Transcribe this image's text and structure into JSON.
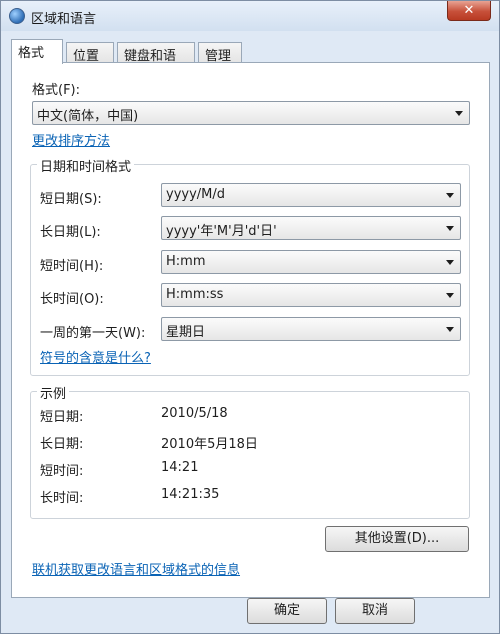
{
  "window": {
    "title": "区域和语言",
    "close_glyph": "✕"
  },
  "tabs": [
    {
      "label": "格式"
    },
    {
      "label": "位置"
    },
    {
      "label": "键盘和语言"
    },
    {
      "label": "管理"
    }
  ],
  "format": {
    "label": "格式(F):",
    "value": "中文(简体，中国)",
    "sort_link": "更改排序方法"
  },
  "datetime_group": {
    "title": "日期和时间格式",
    "rows": [
      {
        "label": "短日期(S):",
        "value": "yyyy/M/d"
      },
      {
        "label": "长日期(L):",
        "value": "yyyy'年'M'月'd'日'"
      },
      {
        "label": "短时间(H):",
        "value": "H:mm"
      },
      {
        "label": "长时间(O):",
        "value": "H:mm:ss"
      },
      {
        "label": "一周的第一天(W):",
        "value": "星期日"
      }
    ],
    "notation_link": "符号的含意是什么?"
  },
  "example_group": {
    "title": "示例",
    "rows": [
      {
        "label": "短日期:",
        "value": "2010/5/18"
      },
      {
        "label": "长日期:",
        "value": "2010年5月18日"
      },
      {
        "label": "短时间:",
        "value": "14:21"
      },
      {
        "label": "长时间:",
        "value": "14:21:35"
      }
    ]
  },
  "other_settings_button": "其他设置(D)...",
  "online_link": "联机获取更改语言和区域格式的信息",
  "footer": {
    "ok_label": "确定",
    "cancel_label": "取消"
  }
}
